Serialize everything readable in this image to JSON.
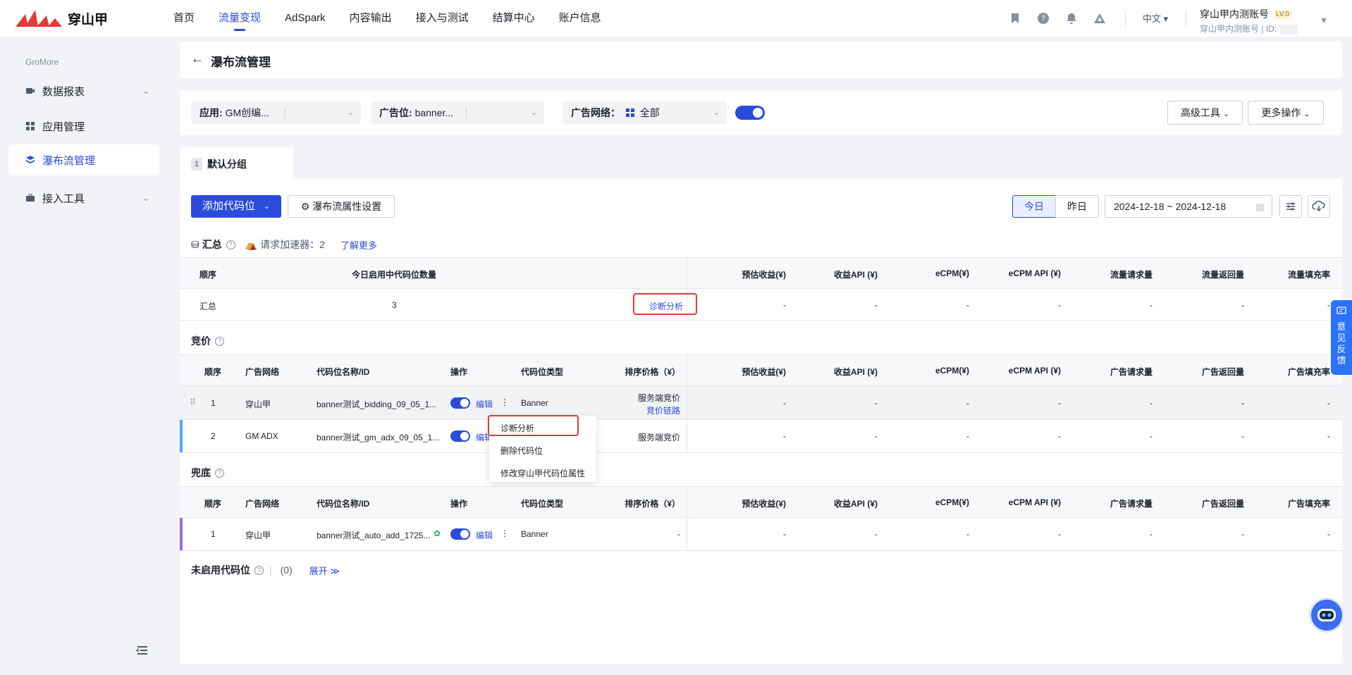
{
  "brand": {
    "name": "穿山甲",
    "accent": "#2a4bdc"
  },
  "nav": [
    {
      "label": "首页",
      "active": false
    },
    {
      "label": "流量变现",
      "active": true
    },
    {
      "label": "AdSpark",
      "active": false
    },
    {
      "label": "内容输出",
      "active": false
    },
    {
      "label": "接入与测试",
      "active": false
    },
    {
      "label": "结算中心",
      "active": false
    },
    {
      "label": "账户信息",
      "active": false
    }
  ],
  "top_icons": [
    "bookmark-icon",
    "help-icon",
    "bell-icon",
    "warning-icon"
  ],
  "language": "中文",
  "account": {
    "name": "穿山甲内测账号",
    "level": "LV.0",
    "sub": "穿山甲内测账号",
    "id_label": "ID:"
  },
  "sidebar": {
    "group": "GroMore",
    "items": [
      {
        "label": "数据报表",
        "icon": "video-report-icon",
        "expandable": true
      },
      {
        "label": "应用管理",
        "icon": "grid-icon",
        "expandable": false
      },
      {
        "label": "瀑布流管理",
        "icon": "layers-icon",
        "active": true
      },
      {
        "label": "接入工具",
        "icon": "toolbox-icon",
        "expandable": true
      }
    ]
  },
  "page": {
    "title": "瀑布流管理"
  },
  "filters": {
    "app": {
      "label": "应用:",
      "value": "GM创编..."
    },
    "slot": {
      "label": "广告位:",
      "value": "banner..."
    },
    "network": {
      "label": "广告网络：",
      "value": "全部"
    },
    "toggle_on": true,
    "advanced": "高级工具",
    "more": "更多操作"
  },
  "group_tab": {
    "num": "1",
    "label": "默认分组"
  },
  "toolbar": {
    "add": "添加代码位",
    "settings": "瀑布流属性设置",
    "today": "今日",
    "yesterday": "昨日",
    "date_range": "2024-12-18 ~ 2024-12-18"
  },
  "summary": {
    "title": "汇总",
    "accelerator_label": "请求加速器：",
    "accelerator_value": "2",
    "learn_more": "了解更多",
    "headers": [
      "顺序",
      "今日启用中代码位数量",
      "预估收益(¥)",
      "收益API (¥)",
      "eCPM(¥)",
      "eCPM API (¥)",
      "流量请求量",
      "流量返回量",
      "流量填充率"
    ],
    "row": {
      "name": "汇总",
      "count": "3",
      "diag": "诊断分析",
      "metrics": [
        "-",
        "-",
        "-",
        "-",
        "-",
        "-",
        "-"
      ]
    }
  },
  "bidding": {
    "title": "竞价",
    "headers": [
      "顺序",
      "广告网络",
      "代码位名称/ID",
      "操作",
      "代码位类型",
      "排序价格（¥）",
      "预估收益(¥)",
      "收益API (¥)",
      "eCPM(¥)",
      "eCPM API (¥)",
      "广告请求量",
      "广告返回量",
      "广告填充率"
    ],
    "rows": [
      {
        "order": "1",
        "network": "穿山甲",
        "name": "banner测试_bidding_09_05_1...",
        "edit": "编辑",
        "type": "Banner",
        "price": "服务端竞价",
        "price_link": "竞价链路",
        "metrics": [
          "-",
          "-",
          "-",
          "-",
          "-",
          "-",
          "-"
        ]
      },
      {
        "order": "2",
        "network": "GM ADX",
        "name": "banner测试_gm_adx_09_05_1...",
        "edit": "编辑",
        "type": "",
        "price": "服务端竞价",
        "price_link": "",
        "metrics": [
          "-",
          "-",
          "-",
          "-",
          "-",
          "-",
          "-"
        ]
      }
    ]
  },
  "fallback": {
    "title": "兜底",
    "headers": [
      "顺序",
      "广告网络",
      "代码位名称/ID",
      "操作",
      "代码位类型",
      "排序价格（¥）",
      "预估收益(¥)",
      "收益API (¥)",
      "eCPM(¥)",
      "eCPM API (¥)",
      "广告请求量",
      "广告返回量",
      "广告填充率"
    ],
    "rows": [
      {
        "order": "1",
        "network": "穿山甲",
        "name": "banner测试_auto_add_1725...",
        "edit": "编辑",
        "type": "Banner",
        "price": "-",
        "metrics": [
          "-",
          "-",
          "-",
          "-",
          "-",
          "-",
          "-"
        ]
      }
    ]
  },
  "disabled": {
    "title": "未启用代码位",
    "count": "(0)",
    "expand": "展开"
  },
  "context_menu": [
    "诊断分析",
    "删除代码位",
    "修改穿山甲代码位属性"
  ],
  "feedback": "意见反馈"
}
